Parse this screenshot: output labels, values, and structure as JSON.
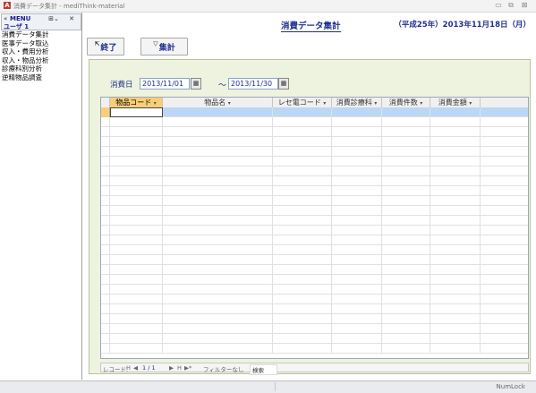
{
  "window": {
    "app_icon": "A",
    "title": "消費データ集計 - mediThink-material",
    "minimize_icon": "minimize-icon",
    "restore_icon": "restore-icon",
    "close_icon": "close-icon"
  },
  "sidebar": {
    "menu_label": "MENU",
    "user_label": "ユーザ 1",
    "items": [
      {
        "label": "消費データ集計"
      },
      {
        "label": "医事データ取込"
      },
      {
        "label": "収入・費用分析"
      },
      {
        "label": "収入・物品分析"
      },
      {
        "label": "診療科別分析"
      },
      {
        "label": "逆精物品調査"
      }
    ]
  },
  "header": {
    "title": "消費データ集計",
    "date": "（平成25年）2013年11月18日（月）"
  },
  "toolbar": {
    "exit_label": "終了",
    "aggregate_label": "集計"
  },
  "filter": {
    "date_label": "消費日",
    "start_date": "2013/11/01",
    "separator": "～",
    "end_date": "2013/11/30"
  },
  "grid": {
    "columns": [
      {
        "label": "物品コード"
      },
      {
        "label": "物品名"
      },
      {
        "label": "レセ電コード"
      },
      {
        "label": "消費診療科"
      },
      {
        "label": "消費件数"
      },
      {
        "label": "消費金額"
      }
    ],
    "rows": []
  },
  "record_nav": {
    "label": "レコード:",
    "first": "H",
    "prev": "◀",
    "position": "1 / 1",
    "next": "▶",
    "last": "H",
    "new": "▶*",
    "filter": "フィルターなし",
    "search": "検索"
  },
  "status": {
    "numlock": "NumLock"
  },
  "colors": {
    "accent": "#1f2f8f",
    "panel": "#eef3df",
    "header_selected": "#f8cf78",
    "new_row": "#bcd7f5"
  }
}
